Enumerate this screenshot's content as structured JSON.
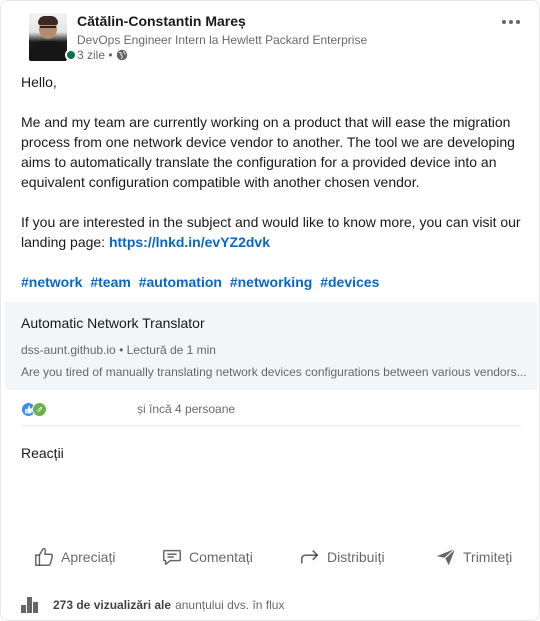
{
  "author": {
    "name": "Cătălin-Constantin Mareș",
    "headline": "DevOps Engineer Intern la Hewlett Packard Enterprise",
    "post_age": "3 zile •",
    "visibility_icon": "globe-icon",
    "status": "online"
  },
  "post": {
    "paragraphs": [
      "Hello,",
      "Me and my team are currently working on a product that will ease the migration process from one network device vendor to another. The tool we are developing aims to automatically translate the configuration for a provided device into an equivalent configuration compatible with another chosen vendor.",
      "If you are interested in the subject and would like to know more, you can visit our landing page: "
    ],
    "link_text": "https://lnkd.in/evYZ2dvk",
    "hashtags": [
      "#network",
      "#team",
      "#automation",
      "#networking",
      "#devices"
    ]
  },
  "preview": {
    "title": "Automatic Network Translator",
    "source": "dss-aunt.github.io • Lectură de 1 min",
    "description": "Are you tired of manually translating network devices configurations between various vendors..."
  },
  "social": {
    "reactions_text": "și încă 4 persoane",
    "reaction_icons": [
      "like-icon",
      "support-icon"
    ]
  },
  "reactions_heading": "Reacții",
  "actions": {
    "like": "Apreciați",
    "comment": "Comentați",
    "repost": "Distribuiți",
    "send": "Trimiteți"
  },
  "views": {
    "count": "273 de vizualizări ale",
    "suffix": "anunțului dvs. în flux"
  },
  "colors": {
    "link": "#0a66c2",
    "presence": "#057642",
    "preview_bg": "#f3f6f8"
  }
}
